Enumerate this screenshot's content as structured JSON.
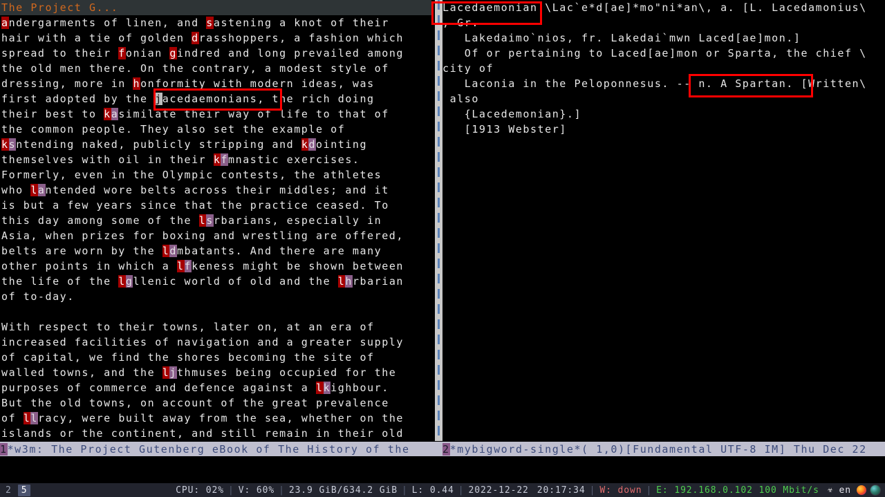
{
  "window": {
    "left_buffer": {
      "header_line": "The Project G...",
      "lines": [
        [
          {
            "t": "a",
            "s": "lead"
          },
          {
            "t": "ndergarments of linen, and "
          },
          {
            "t": "s",
            "s": "lead"
          },
          {
            "t": "astening a knot of their"
          }
        ],
        [
          {
            "t": "hair with a tie of golden "
          },
          {
            "t": "d",
            "s": "lead"
          },
          {
            "t": "rasshoppers, a fashion which"
          }
        ],
        [
          {
            "t": "spread to their "
          },
          {
            "t": "f",
            "s": "lead"
          },
          {
            "t": "onian "
          },
          {
            "t": "g",
            "s": "lead"
          },
          {
            "t": "indred and long prevailed among"
          }
        ],
        [
          {
            "t": "the old men there. On the contrary, a modest style of"
          }
        ],
        [
          {
            "t": "dressing, more in "
          },
          {
            "t": "h",
            "s": "lead"
          },
          {
            "t": "onformity with modern ideas, was"
          }
        ],
        [
          {
            "t": "first adopted by the "
          },
          {
            "t": "j",
            "s": "cursor"
          },
          {
            "t": "acedaemonians, the rich doing"
          }
        ],
        [
          {
            "t": "their best to "
          },
          {
            "t": "k",
            "s": "lead"
          },
          {
            "t": "a",
            "s": "lead2"
          },
          {
            "t": "similate their way of life to that of"
          }
        ],
        [
          {
            "t": "the common people. They also set the example of"
          }
        ],
        [
          {
            "t": "k",
            "s": "lead"
          },
          {
            "t": "s",
            "s": "lead2"
          },
          {
            "t": "ntending naked, publicly stripping and "
          },
          {
            "t": "k",
            "s": "lead"
          },
          {
            "t": "d",
            "s": "lead2"
          },
          {
            "t": "ointing"
          }
        ],
        [
          {
            "t": "themselves with oil in their "
          },
          {
            "t": "k",
            "s": "lead"
          },
          {
            "t": "f",
            "s": "lead2"
          },
          {
            "t": "mnastic exercises."
          }
        ],
        [
          {
            "t": "Formerly, even in the Olympic contests, the athletes"
          }
        ],
        [
          {
            "t": "who "
          },
          {
            "t": "l",
            "s": "lead"
          },
          {
            "t": "a",
            "s": "lead2"
          },
          {
            "t": "ntended wore belts across their middles; and it"
          }
        ],
        [
          {
            "t": "is but a few years since that the practice ceased. To"
          }
        ],
        [
          {
            "t": "this day among some of the "
          },
          {
            "t": "l",
            "s": "lead"
          },
          {
            "t": "s",
            "s": "lead2"
          },
          {
            "t": "rbarians, especially in"
          }
        ],
        [
          {
            "t": "Asia, when prizes for boxing and wrestling are offered,"
          }
        ],
        [
          {
            "t": "belts are worn by the "
          },
          {
            "t": "l",
            "s": "lead"
          },
          {
            "t": "d",
            "s": "lead2"
          },
          {
            "t": "mbatants. And there are many"
          }
        ],
        [
          {
            "t": "other points in which a "
          },
          {
            "t": "l",
            "s": "lead"
          },
          {
            "t": "f",
            "s": "lead2"
          },
          {
            "t": "keness might be shown between"
          }
        ],
        [
          {
            "t": "the life of the "
          },
          {
            "t": "l",
            "s": "lead"
          },
          {
            "t": "g",
            "s": "lead2"
          },
          {
            "t": "llenic world of old and the "
          },
          {
            "t": "l",
            "s": "lead"
          },
          {
            "t": "h",
            "s": "lead2"
          },
          {
            "t": "rbarian"
          }
        ],
        [
          {
            "t": "of to-day."
          }
        ],
        [
          {
            "t": ""
          }
        ],
        [
          {
            "t": "With respect to their towns, later on, at an era of"
          }
        ],
        [
          {
            "t": "increased facilities of navigation and a greater supply"
          }
        ],
        [
          {
            "t": "of capital, we find the shores becoming the site of"
          }
        ],
        [
          {
            "t": "walled towns, and the "
          },
          {
            "t": "l",
            "s": "lead"
          },
          {
            "t": "j",
            "s": "lead2"
          },
          {
            "t": "thmuses being occupied for the"
          }
        ],
        [
          {
            "t": "purposes of commerce and defence against a "
          },
          {
            "t": "l",
            "s": "lead"
          },
          {
            "t": "k",
            "s": "lead2"
          },
          {
            "t": "ighbour."
          }
        ],
        [
          {
            "t": "But the old towns, on account of the great prevalence"
          }
        ],
        [
          {
            "t": "of "
          },
          {
            "t": "l",
            "s": "lead"
          },
          {
            "t": "l",
            "s": "lead2"
          },
          {
            "t": "racy, were built away from the sea, whether on the"
          }
        ],
        [
          {
            "t": "islands or the continent, and still remain in their old"
          }
        ]
      ],
      "modeline": {
        "window_number": "1",
        "text": "*w3m: The Project Gutenberg eBook of The History of the "
      }
    },
    "right_buffer": {
      "lines": [
        "Lacedaemonian \\Lac`e*d[ae]*mo\"ni*an\\, a. [L. Lacedamonius\\",
        ", Gr.",
        "   Lakedaimo`nios, fr. Lakedai`mwn Laced[ae]mon.]",
        "   Of or pertaining to Laced[ae]mon or Sparta, the chief \\",
        "city of",
        "   Laconia in the Peloponnesus. -- n. A Spartan. [Written\\",
        " also",
        "   {Lacedemonian}.]",
        "   [1913 Webster]"
      ],
      "modeline": {
        "window_number": "2",
        "text": "*mybigword-single*( 1,0)[Fundamental UTF-8 IM] Thu Dec 22"
      }
    }
  },
  "annotations": [
    {
      "id": "annot-1",
      "label": "lacedaemonians-highlight"
    },
    {
      "id": "annot-2",
      "label": "headword-highlight"
    },
    {
      "id": "annot-3",
      "label": "noun-definition-highlight"
    }
  ],
  "statusbar": {
    "workspaces": [
      {
        "label": "2",
        "active": false
      },
      {
        "label": "5",
        "active": true
      }
    ],
    "cpu": "CPU: 02%",
    "memory_pct": "V: 60%",
    "disk": "23.9 GiB/634.2 GiB",
    "load": "L: 0.44",
    "date": "2022-12-22",
    "time": "20:17:34",
    "wifi": "W: down",
    "ethernet": "E: 192.168.0.102 100 Mbit/s",
    "keyboard_layout": "en",
    "separator": "|",
    "tray": [
      "dropbox-icon",
      "firefox-icon",
      "globe-icon"
    ]
  },
  "colors": {
    "background": "#000000",
    "foreground": "#e8e8e8",
    "header_line_bg": "#2e3436",
    "header_line_fg": "#d2691e",
    "lead_bg": "#a60000",
    "lead2_bg": "#8a5f8a",
    "cursor_bg": "#bdbdbd",
    "modeline_bg": "#bfbfcf",
    "modeline_fg": "#3b4a7a",
    "window_number_bg": "#8b5a8b",
    "annotation_stroke": "#ff0000",
    "scrollbar": "#c9c9c9",
    "fill_column_line": "#5b82b8",
    "sysbar_bg": "#22242e",
    "wifi_color": "#e06c6c",
    "ethernet_color": "#4fd04f"
  }
}
